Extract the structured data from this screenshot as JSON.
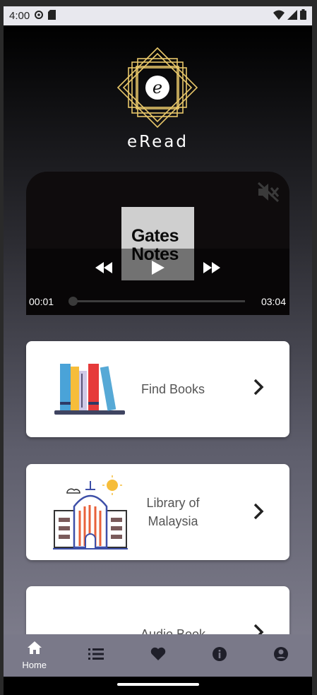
{
  "status": {
    "time": "4:00"
  },
  "brand": {
    "logo_letter": "e",
    "name": "eRead",
    "gold": "#e8c76a"
  },
  "video": {
    "thumb_text_line1": "Gates",
    "thumb_text_line2": "Notes",
    "current_time": "00:01",
    "duration": "03:04",
    "progress": 0.005
  },
  "cards": [
    {
      "label": "Find Books",
      "icon": "books-icon"
    },
    {
      "label": "Library of Malaysia",
      "icon": "library-building-icon"
    },
    {
      "label": "Audio Book",
      "icon": "audio-book-icon"
    }
  ],
  "nav": [
    {
      "label": "Home",
      "icon": "home-icon",
      "active": true
    },
    {
      "label": "",
      "icon": "list-icon"
    },
    {
      "label": "",
      "icon": "heart-icon"
    },
    {
      "label": "",
      "icon": "info-icon"
    },
    {
      "label": "",
      "icon": "account-icon"
    }
  ]
}
